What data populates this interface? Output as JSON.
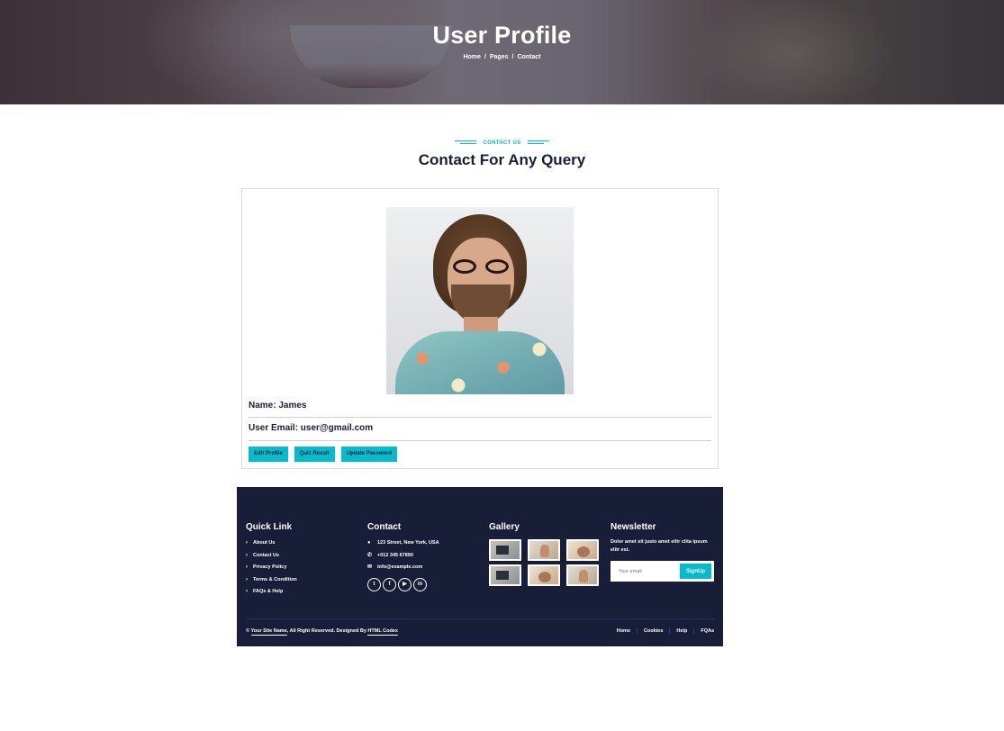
{
  "hero": {
    "title": "User Profile",
    "breadcrumb": [
      "Home",
      "Pages",
      "Contact"
    ],
    "separator": "/"
  },
  "section": {
    "subtitle": "CONTACT US",
    "title": "Contact For Any Query"
  },
  "profile": {
    "name_line": "Name: James",
    "email_line": "User Email: user@gmail.com",
    "buttons": [
      "Edit Profile",
      "Quiz Result",
      "Update Password"
    ]
  },
  "footer": {
    "quick_link": {
      "heading": "Quick Link",
      "items": [
        "About Us",
        "Contact Us",
        "Privacy Policy",
        "Terms & Condition",
        "FAQs & Help"
      ]
    },
    "contact": {
      "heading": "Contact",
      "address": "123 Street, New York, USA",
      "phone": "+012 345 67890",
      "email": "info@example.com",
      "socials": [
        "twitter-icon",
        "facebook-icon",
        "youtube-icon",
        "linkedin-icon"
      ]
    },
    "gallery": {
      "heading": "Gallery"
    },
    "newsletter": {
      "heading": "Newsletter",
      "text": "Dolor amet sit justo amet elitr clita ipsum elitr est.",
      "placeholder": "Your email",
      "button": "SignUp"
    },
    "copyright": {
      "prefix": "©",
      "site": "Your Site Name",
      "middle": ", All Right Reserved. Designed By",
      "designer": "HTML Codex"
    },
    "menu": [
      "Home",
      "Cookies",
      "Help",
      "FQAs"
    ]
  },
  "colors": {
    "accent": "#06bbcc",
    "dark": "#181d38"
  }
}
